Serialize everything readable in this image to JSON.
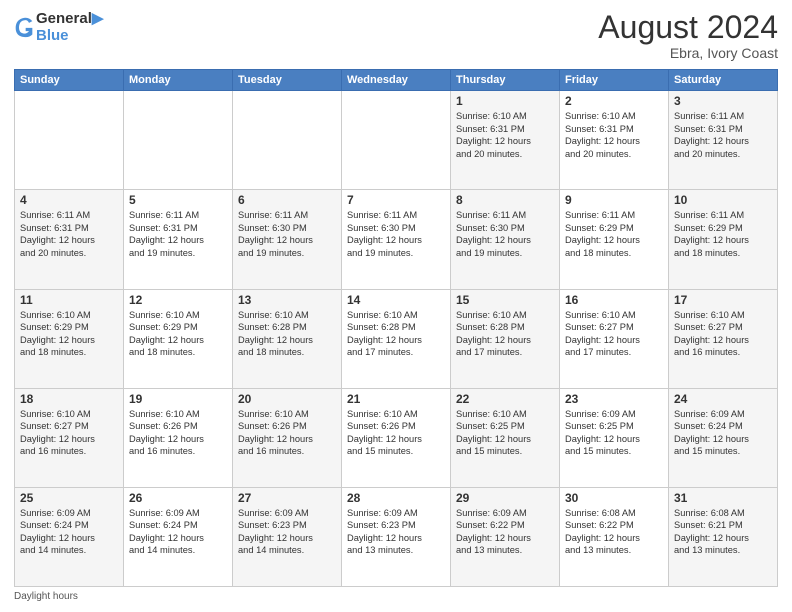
{
  "header": {
    "logo_line1": "General",
    "logo_line2": "Blue",
    "month_year": "August 2024",
    "location": "Ebra, Ivory Coast"
  },
  "days_of_week": [
    "Sunday",
    "Monday",
    "Tuesday",
    "Wednesday",
    "Thursday",
    "Friday",
    "Saturday"
  ],
  "footer": "Daylight hours",
  "weeks": [
    [
      {
        "day": "",
        "info": ""
      },
      {
        "day": "",
        "info": ""
      },
      {
        "day": "",
        "info": ""
      },
      {
        "day": "",
        "info": ""
      },
      {
        "day": "1",
        "info": "Sunrise: 6:10 AM\nSunset: 6:31 PM\nDaylight: 12 hours\nand 20 minutes."
      },
      {
        "day": "2",
        "info": "Sunrise: 6:10 AM\nSunset: 6:31 PM\nDaylight: 12 hours\nand 20 minutes."
      },
      {
        "day": "3",
        "info": "Sunrise: 6:11 AM\nSunset: 6:31 PM\nDaylight: 12 hours\nand 20 minutes."
      }
    ],
    [
      {
        "day": "4",
        "info": "Sunrise: 6:11 AM\nSunset: 6:31 PM\nDaylight: 12 hours\nand 20 minutes."
      },
      {
        "day": "5",
        "info": "Sunrise: 6:11 AM\nSunset: 6:31 PM\nDaylight: 12 hours\nand 19 minutes."
      },
      {
        "day": "6",
        "info": "Sunrise: 6:11 AM\nSunset: 6:30 PM\nDaylight: 12 hours\nand 19 minutes."
      },
      {
        "day": "7",
        "info": "Sunrise: 6:11 AM\nSunset: 6:30 PM\nDaylight: 12 hours\nand 19 minutes."
      },
      {
        "day": "8",
        "info": "Sunrise: 6:11 AM\nSunset: 6:30 PM\nDaylight: 12 hours\nand 19 minutes."
      },
      {
        "day": "9",
        "info": "Sunrise: 6:11 AM\nSunset: 6:29 PM\nDaylight: 12 hours\nand 18 minutes."
      },
      {
        "day": "10",
        "info": "Sunrise: 6:11 AM\nSunset: 6:29 PM\nDaylight: 12 hours\nand 18 minutes."
      }
    ],
    [
      {
        "day": "11",
        "info": "Sunrise: 6:10 AM\nSunset: 6:29 PM\nDaylight: 12 hours\nand 18 minutes."
      },
      {
        "day": "12",
        "info": "Sunrise: 6:10 AM\nSunset: 6:29 PM\nDaylight: 12 hours\nand 18 minutes."
      },
      {
        "day": "13",
        "info": "Sunrise: 6:10 AM\nSunset: 6:28 PM\nDaylight: 12 hours\nand 18 minutes."
      },
      {
        "day": "14",
        "info": "Sunrise: 6:10 AM\nSunset: 6:28 PM\nDaylight: 12 hours\nand 17 minutes."
      },
      {
        "day": "15",
        "info": "Sunrise: 6:10 AM\nSunset: 6:28 PM\nDaylight: 12 hours\nand 17 minutes."
      },
      {
        "day": "16",
        "info": "Sunrise: 6:10 AM\nSunset: 6:27 PM\nDaylight: 12 hours\nand 17 minutes."
      },
      {
        "day": "17",
        "info": "Sunrise: 6:10 AM\nSunset: 6:27 PM\nDaylight: 12 hours\nand 16 minutes."
      }
    ],
    [
      {
        "day": "18",
        "info": "Sunrise: 6:10 AM\nSunset: 6:27 PM\nDaylight: 12 hours\nand 16 minutes."
      },
      {
        "day": "19",
        "info": "Sunrise: 6:10 AM\nSunset: 6:26 PM\nDaylight: 12 hours\nand 16 minutes."
      },
      {
        "day": "20",
        "info": "Sunrise: 6:10 AM\nSunset: 6:26 PM\nDaylight: 12 hours\nand 16 minutes."
      },
      {
        "day": "21",
        "info": "Sunrise: 6:10 AM\nSunset: 6:26 PM\nDaylight: 12 hours\nand 15 minutes."
      },
      {
        "day": "22",
        "info": "Sunrise: 6:10 AM\nSunset: 6:25 PM\nDaylight: 12 hours\nand 15 minutes."
      },
      {
        "day": "23",
        "info": "Sunrise: 6:09 AM\nSunset: 6:25 PM\nDaylight: 12 hours\nand 15 minutes."
      },
      {
        "day": "24",
        "info": "Sunrise: 6:09 AM\nSunset: 6:24 PM\nDaylight: 12 hours\nand 15 minutes."
      }
    ],
    [
      {
        "day": "25",
        "info": "Sunrise: 6:09 AM\nSunset: 6:24 PM\nDaylight: 12 hours\nand 14 minutes."
      },
      {
        "day": "26",
        "info": "Sunrise: 6:09 AM\nSunset: 6:24 PM\nDaylight: 12 hours\nand 14 minutes."
      },
      {
        "day": "27",
        "info": "Sunrise: 6:09 AM\nSunset: 6:23 PM\nDaylight: 12 hours\nand 14 minutes."
      },
      {
        "day": "28",
        "info": "Sunrise: 6:09 AM\nSunset: 6:23 PM\nDaylight: 12 hours\nand 13 minutes."
      },
      {
        "day": "29",
        "info": "Sunrise: 6:09 AM\nSunset: 6:22 PM\nDaylight: 12 hours\nand 13 minutes."
      },
      {
        "day": "30",
        "info": "Sunrise: 6:08 AM\nSunset: 6:22 PM\nDaylight: 12 hours\nand 13 minutes."
      },
      {
        "day": "31",
        "info": "Sunrise: 6:08 AM\nSunset: 6:21 PM\nDaylight: 12 hours\nand 13 minutes."
      }
    ]
  ]
}
